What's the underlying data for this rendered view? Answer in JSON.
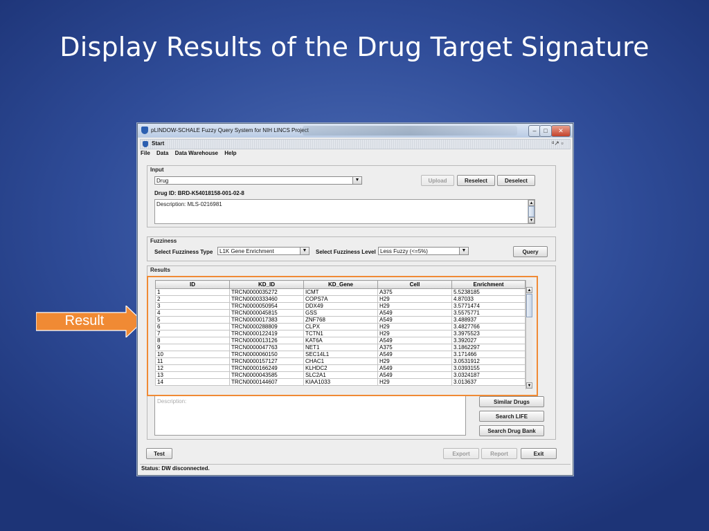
{
  "slide": {
    "title": "Display Results of the Drug Target Signature"
  },
  "callout": {
    "label": "Result",
    "color": "#f08a34"
  },
  "window": {
    "title": "pLINDOW-SCHALE Fuzzy Query System for NIH LINCS Project",
    "inner_title": "Start",
    "controls": {
      "minimize": "–",
      "maximize": "□",
      "close": "✕"
    },
    "inner_controls": "ᵅ↗ ▫"
  },
  "menu": [
    "File",
    "Data",
    "Data Warehouse",
    "Help"
  ],
  "input": {
    "title": "Input",
    "type_value": "Drug",
    "upload_label": "Upload",
    "reselect_label": "Reselect",
    "deselect_label": "Deselect",
    "drug_id": "Drug ID: BRD-K54018158-001-02-8",
    "description": "Description:  MLS-0216981"
  },
  "fuzziness": {
    "title": "Fuzziness",
    "type_label": "Select Fuzziness Type",
    "type_value": "L1K Gene Enrichment",
    "level_label": "Select Fuzziness Level",
    "level_value": "Less Fuzzy (<=5%)",
    "query_label": "Query"
  },
  "results": {
    "title": "Results",
    "columns": [
      "ID",
      "KD_ID",
      "KD_Gene",
      "Cell",
      "Enrichment"
    ],
    "rows": [
      [
        "1",
        "TRCN0000035272",
        "ICMT",
        "A375",
        "5.5238185"
      ],
      [
        "2",
        "TRCN0000333460",
        "COPS7A",
        "H29",
        "4.87033"
      ],
      [
        "3",
        "TRCN0000050954",
        "DDX49",
        "H29",
        "3.5771474"
      ],
      [
        "4",
        "TRCN0000045815",
        "GSS",
        "A549",
        "3.5575771"
      ],
      [
        "5",
        "TRCN0000017383",
        "ZNF768",
        "A549",
        "3.488937"
      ],
      [
        "6",
        "TRCN0000288809",
        "CLPX",
        "H29",
        "3.4827766"
      ],
      [
        "7",
        "TRCN0000122419",
        "TCTN1",
        "H29",
        "3.3975523"
      ],
      [
        "8",
        "TRCN0000013126",
        "KAT6A",
        "A549",
        "3.392027"
      ],
      [
        "9",
        "TRCN0000047763",
        "NET1",
        "A375",
        "3.1862297"
      ],
      [
        "10",
        "TRCN0000060150",
        "SEC14L1",
        "A549",
        "3.171466"
      ],
      [
        "11",
        "TRCN0000157127",
        "CHAC1",
        "H29",
        "3.0531912"
      ],
      [
        "12",
        "TRCN0000166249",
        "KLHDC2",
        "A549",
        "3.0393155"
      ],
      [
        "13",
        "TRCN0000043585",
        "SLC2A1",
        "A549",
        "3.0324187"
      ],
      [
        "14",
        "TRCN0000144607",
        "KIAA1033",
        "H29",
        "3.013637"
      ]
    ],
    "description_placeholder": "Description:",
    "similar_drugs_label": "Similar Drugs",
    "search_life_label": "Search LIFE",
    "search_drugbank_label": "Search Drug Bank"
  },
  "footer": {
    "test_label": "Test",
    "export_label": "Export",
    "report_label": "Report",
    "exit_label": "Exit",
    "status": "Status: DW disconnected."
  }
}
